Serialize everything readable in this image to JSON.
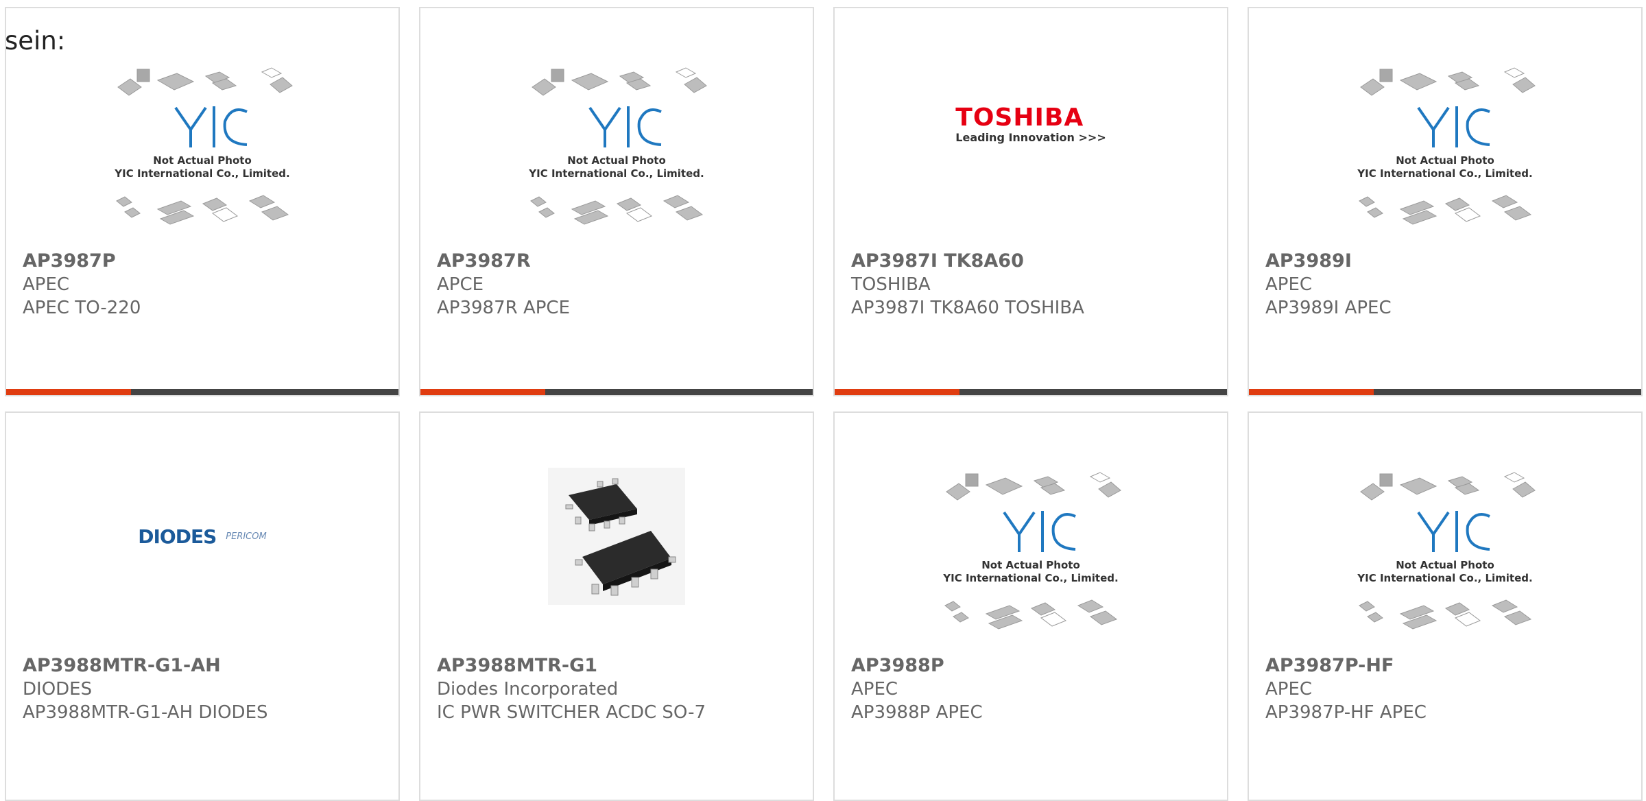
{
  "lead_text": "sein:",
  "placeholder_image": {
    "line1": "Not Actual Photo",
    "line2": "YIC International Co., Limited."
  },
  "toshiba_logo": {
    "brand": "TOSHIBA",
    "tagline": "Leading Innovation >>>"
  },
  "diodes_logo": {
    "brand": "DIODES",
    "secondary": "PERICOM"
  },
  "colors": {
    "accent_bar": "#e03c10",
    "bar": "#444444",
    "text": "#666666"
  },
  "products": [
    {
      "part_number": "AP3987P",
      "manufacturer": "APEC",
      "description": "APEC TO-220",
      "image": "yic-placeholder"
    },
    {
      "part_number": "AP3987R",
      "manufacturer": "APCE",
      "description": "AP3987R APCE",
      "image": "yic-placeholder"
    },
    {
      "part_number": "AP3987I TK8A60",
      "manufacturer": "TOSHIBA",
      "description": "AP3987I TK8A60 TOSHIBA",
      "image": "toshiba-logo"
    },
    {
      "part_number": "AP3989I",
      "manufacturer": "APEC",
      "description": "AP3989I APEC",
      "image": "yic-placeholder"
    },
    {
      "part_number": "AP3988MTR-G1-AH",
      "manufacturer": "DIODES",
      "description": "AP3988MTR-G1-AH DIODES",
      "image": "diodes-logo"
    },
    {
      "part_number": "AP3988MTR-G1",
      "manufacturer": "Diodes Incorporated",
      "description": "IC PWR SWITCHER ACDC SO-7",
      "image": "so7-chip-photo"
    },
    {
      "part_number": "AP3988P",
      "manufacturer": "APEC",
      "description": "AP3988P APEC",
      "image": "yic-placeholder"
    },
    {
      "part_number": "AP3987P-HF",
      "manufacturer": "APEC",
      "description": "AP3987P-HF APEC",
      "image": "yic-placeholder"
    }
  ]
}
